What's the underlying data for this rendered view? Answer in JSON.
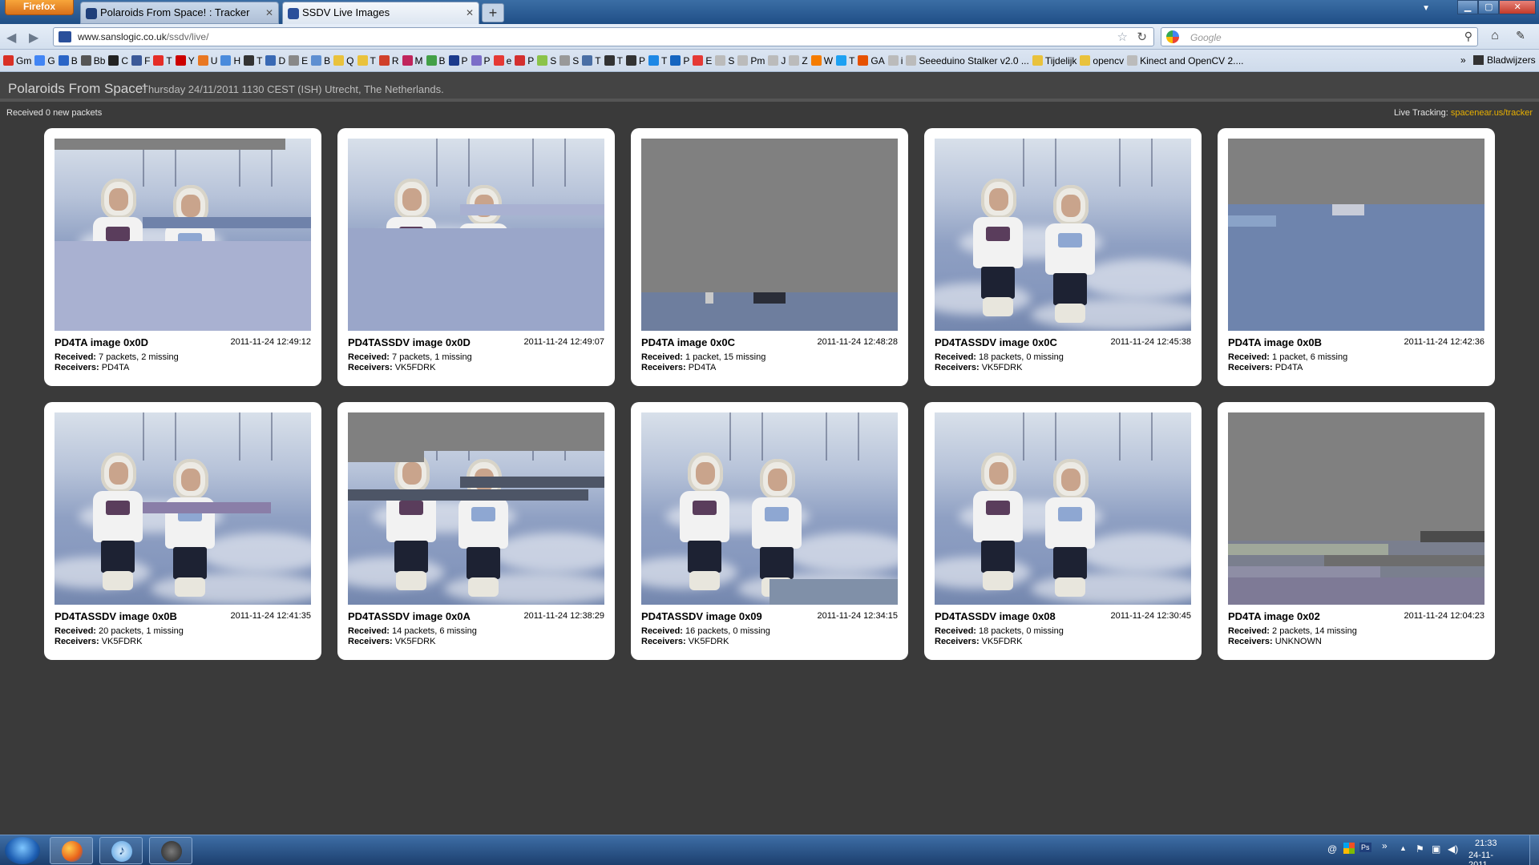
{
  "browser": {
    "menu_button": "Firefox",
    "tabs": [
      {
        "title": "Polaroids From Space! : Tracker"
      },
      {
        "title": "SSDV Live Images"
      }
    ],
    "new_tab": "+",
    "url_host": "www.sanslogic.co.uk",
    "url_path": "/ssdv/live/",
    "search_placeholder": "Google",
    "bookmarks_toolbar": [
      {
        "label": "Gm",
        "color": "#d93025"
      },
      {
        "label": "G",
        "color": "#4285f4"
      },
      {
        "label": "B",
        "color": "#2b65c6"
      },
      {
        "label": "Bb",
        "color": "#555555"
      },
      {
        "label": "C",
        "color": "#222222"
      },
      {
        "label": "F",
        "color": "#3b5998"
      },
      {
        "label": "T",
        "color": "#e52d27"
      },
      {
        "label": "Y",
        "color": "#cc0000"
      },
      {
        "label": "U",
        "color": "#e87722"
      },
      {
        "label": "H",
        "color": "#4a8bdc"
      },
      {
        "label": "T",
        "color": "#333333"
      },
      {
        "label": "D",
        "color": "#3969b4"
      },
      {
        "label": "E",
        "color": "#888888"
      },
      {
        "label": "B",
        "color": "#5e8fd1"
      },
      {
        "label": "Q",
        "color": "#e9c23c"
      },
      {
        "label": "T",
        "color": "#e9c23c"
      },
      {
        "label": "R",
        "color": "#d0402a"
      },
      {
        "label": "M",
        "color": "#c0245b"
      },
      {
        "label": "B",
        "color": "#43a047"
      },
      {
        "label": "P",
        "color": "#1b3a8c"
      },
      {
        "label": "P",
        "color": "#7b6dc8"
      },
      {
        "label": "e",
        "color": "#e53935"
      },
      {
        "label": "P",
        "color": "#d32f2f"
      },
      {
        "label": "S",
        "color": "#8bc34a"
      },
      {
        "label": "S",
        "color": "#999999"
      },
      {
        "label": "T",
        "color": "#4a6fa5"
      },
      {
        "label": "T",
        "color": "#333333"
      },
      {
        "label": "P",
        "color": "#333333"
      },
      {
        "label": "T",
        "color": "#1e88e5"
      },
      {
        "label": "P",
        "color": "#1565c0"
      },
      {
        "label": "E",
        "color": "#e53935"
      },
      {
        "label": "S",
        "color": "#bbbbbb"
      },
      {
        "label": "Pm",
        "color": "#bbbbbb"
      },
      {
        "label": "J",
        "color": "#bbbbbb"
      },
      {
        "label": "Z",
        "color": "#bbbbbb"
      },
      {
        "label": "W",
        "color": "#f57c00"
      },
      {
        "label": "T",
        "color": "#1da1f2"
      },
      {
        "label": "GA",
        "color": "#e65100"
      },
      {
        "label": "i",
        "color": "#bbbbbb"
      },
      {
        "label": "Seeeduino Stalker v2.0 ...",
        "color": "#bbbbbb"
      },
      {
        "label": "Tijdelijk",
        "color": "#e9c23c"
      },
      {
        "label": "opencv",
        "color": "#e9c23c"
      },
      {
        "label": "Kinect and OpenCV 2....",
        "color": "#bbbbbb"
      }
    ],
    "bookmarks_more": "»",
    "bookmarks_folder": "Bladwijzers"
  },
  "page": {
    "title": "Polaroids From Space!",
    "subtitle": "Thursday 24/11/2011 1130 CEST (ISH) Utrecht, The Netherlands.",
    "status": "Received 0 new packets",
    "tracking_label": "Live Tracking:",
    "tracking_link": "spacenear.us/tracker",
    "received_label": "Received:",
    "receivers_label": "Receivers:",
    "images": [
      {
        "title": "PD4TA image 0x0D",
        "date": "2011-11-24 12:49:12",
        "received": "7 packets, 2 missing",
        "receivers": "PD4TA",
        "fill": 0.36
      },
      {
        "title": "PD4TASSDV image 0x0D",
        "date": "2011-11-24 12:49:07",
        "received": "7 packets, 1 missing",
        "receivers": "VK5FDRK",
        "fill": 0.42
      },
      {
        "title": "PD4TA image 0x0C",
        "date": "2011-11-24 12:48:28",
        "received": "1 packet, 15 missing",
        "receivers": "PD4TA",
        "fill": 0.0
      },
      {
        "title": "PD4TASSDV image 0x0C",
        "date": "2011-11-24 12:45:38",
        "received": "18 packets, 0 missing",
        "receivers": "VK5FDRK",
        "fill": 1.0
      },
      {
        "title": "PD4TA image 0x0B",
        "date": "2011-11-24 12:42:36",
        "received": "1 packet, 6 missing",
        "receivers": "PD4TA",
        "fill": 0.0
      },
      {
        "title": "PD4TASSDV image 0x0B",
        "date": "2011-11-24 12:41:35",
        "received": "20 packets, 1 missing",
        "receivers": "VK5FDRK",
        "fill": 1.0
      },
      {
        "title": "PD4TASSDV image 0x0A",
        "date": "2011-11-24 12:38:29",
        "received": "14 packets, 6 missing",
        "receivers": "VK5FDRK",
        "fill": 1.0
      },
      {
        "title": "PD4TASSDV image 0x09",
        "date": "2011-11-24 12:34:15",
        "received": "16 packets, 0 missing",
        "receivers": "VK5FDRK",
        "fill": 1.0
      },
      {
        "title": "PD4TASSDV image 0x08",
        "date": "2011-11-24 12:30:45",
        "received": "18 packets, 0 missing",
        "receivers": "VK5FDRK",
        "fill": 1.0
      },
      {
        "title": "PD4TA image 0x02",
        "date": "2011-11-24 12:04:23",
        "received": "2 packets, 14 missing",
        "receivers": "UNKNOWN",
        "fill": 0.0
      }
    ]
  },
  "taskbar": {
    "time": "21:33",
    "date": "24-11-2011",
    "pinned": [
      "windows-start",
      "firefox",
      "itunes",
      "steam"
    ]
  },
  "colors": {
    "page_bg": "#3a3a3a",
    "tracking_link": "#e8b000",
    "missing_grey": "#808080"
  }
}
